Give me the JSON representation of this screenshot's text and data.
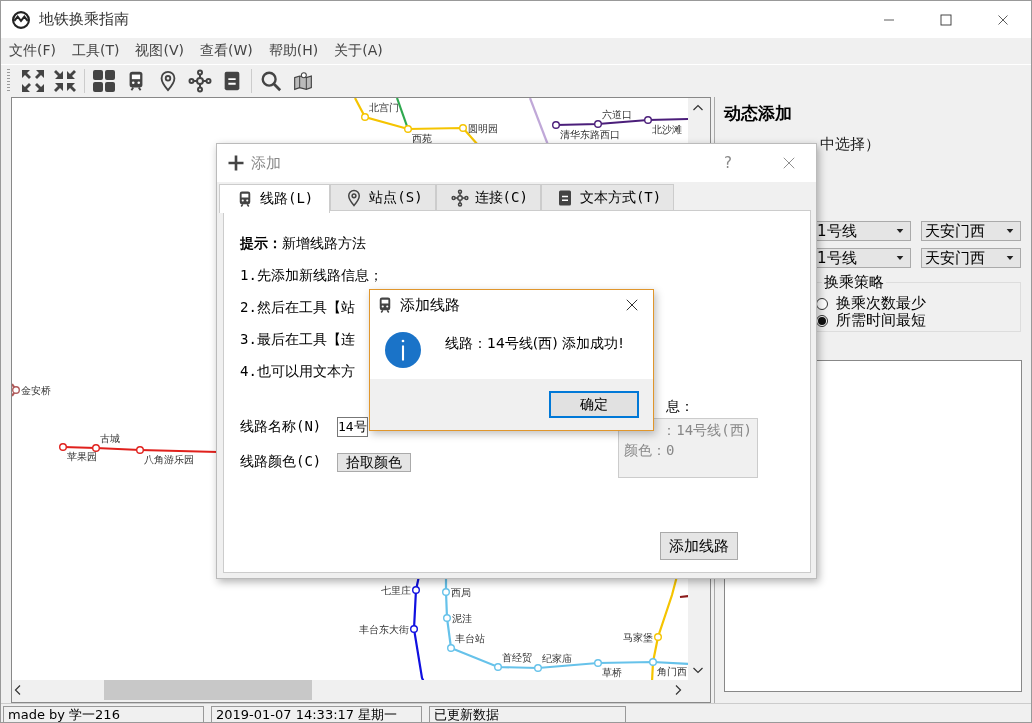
{
  "window": {
    "title": "地铁换乘指南"
  },
  "menu": [
    "文件(F)",
    "工具(T)",
    "视图(V)",
    "查看(W)",
    "帮助(H)",
    "关于(A)"
  ],
  "map": {
    "lines": [
      {
        "color": "#f5c400",
        "stations": [
          "北宫门",
          "西苑",
          "圆明园"
        ]
      },
      {
        "color": "#2fa84f"
      },
      {
        "color": "#c0a8d8"
      },
      {
        "color": "#4b1e7a",
        "stations": [
          "清华东路西口",
          "六道口",
          "北沙滩"
        ]
      },
      {
        "color": "#e0201c",
        "stations": [
          "苹果园",
          "古城",
          "八角游乐园"
        ]
      },
      {
        "color": "#b05a5a",
        "stations": [
          "金安桥"
        ]
      },
      {
        "color": "#1010e0",
        "stations": [
          "七里庄",
          "丰台东大街"
        ]
      },
      {
        "color": "#66c2ea",
        "stations": [
          "西局",
          "泥洼",
          "丰台站",
          "首经贸",
          "纪家庙",
          "草桥",
          "角门西"
        ]
      },
      {
        "color": "#f5c400",
        "stations": [
          "马家堡"
        ]
      },
      {
        "color": "#8b1a1a"
      }
    ]
  },
  "dock": {
    "heading": "动态添加",
    "hint": "中选择）",
    "route_rows": [
      {
        "line": "1号线",
        "station": "天安门西"
      },
      {
        "line": "1号线",
        "station": "天安门西"
      }
    ],
    "strategy": {
      "title": "换乘策略",
      "options": [
        {
          "label": "换乘次数最少",
          "selected": false
        },
        {
          "label": "所需时间最短",
          "selected": true
        }
      ]
    }
  },
  "add_dialog": {
    "title": "添加",
    "help": "?",
    "tabs": [
      {
        "label": "线路(L)",
        "selected": true
      },
      {
        "label": "站点(S)",
        "selected": false
      },
      {
        "label": "连接(C)",
        "selected": false
      },
      {
        "label": "文本方式(T)",
        "selected": false
      }
    ],
    "hint_lines": [
      "**提示：**新增线路方法",
      "1.先添加新线路信息；",
      "2.然后在工具【站",
      "3.最后在工具【连",
      "4.也可以用文本方"
    ],
    "name_label": "线路名称(N)",
    "name_value": "14号",
    "color_label": "线路颜色(C)",
    "pick_color_button": "拾取颜色",
    "info_label": "息：",
    "info_lines": [
      "：14号线(西)",
      "颜色：0"
    ],
    "submit_button": "添加线路"
  },
  "message_box": {
    "title": "添加线路",
    "message": "线路：14号线(西) 添加成功!",
    "ok_button": "确定"
  },
  "status_bar": [
    "made by 学一216",
    "2019-01-07 14:33:17 星期一",
    "已更新数据"
  ]
}
